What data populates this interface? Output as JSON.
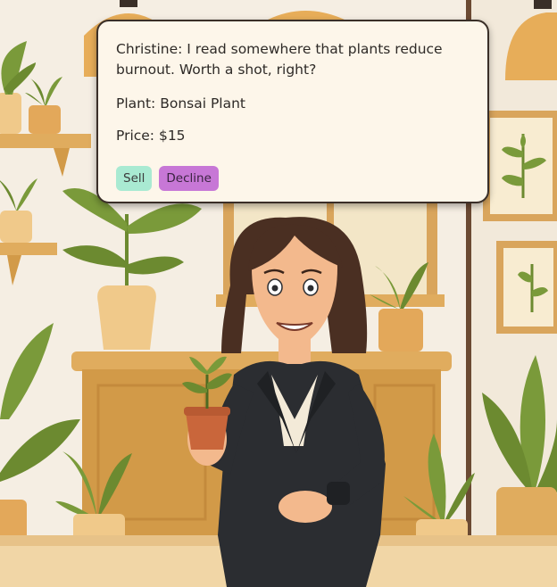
{
  "dialog": {
    "speaker": "Christine",
    "quote": "Christine: I read somewhere that plants reduce burnout. Worth a shot, right?",
    "plant_line": "Plant: Bonsai Plant",
    "price_line": "Price: $15"
  },
  "actions": {
    "sell_label": "Sell",
    "decline_label": "Decline"
  },
  "colors": {
    "wall": "#f4ece0",
    "shelf_wood": "#e0ac5e",
    "leaf_green": "#7a9a3a",
    "jacket": "#2b2d31",
    "sell_button": "#a9ead2",
    "decline_button": "#c777d6"
  },
  "scene_items": [
    "hanging-lamp-icon",
    "potted-plant-icon",
    "framed-leaf-art-icon",
    "wooden-cabinet",
    "window",
    "customer-christine",
    "small-potted-seedling-icon",
    "wristwatch-icon"
  ]
}
